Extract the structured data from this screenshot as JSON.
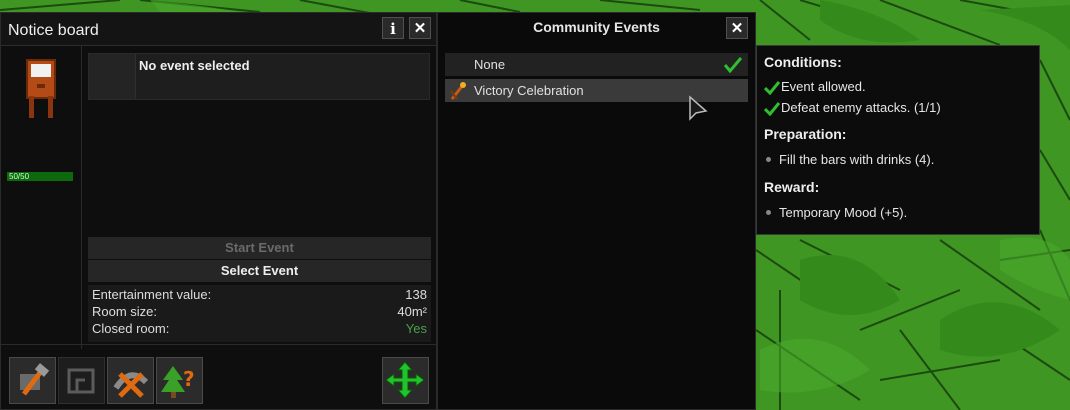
{
  "notice_board": {
    "title": "Notice board",
    "info_button": "i",
    "close_button": "✕",
    "health_text": "50/50",
    "selected_event": "No event selected",
    "start_event_label": "Start Event",
    "select_event_label": "Select Event",
    "stats": [
      {
        "label": "Entertainment value:",
        "value": "138"
      },
      {
        "label": "Room size:",
        "value": "40m²"
      },
      {
        "label": "Closed room:",
        "value": "Yes"
      }
    ],
    "toolbar": [
      "build-hammer-icon",
      "room-outline-icon",
      "demolish-icon",
      "tree-question-icon",
      "move-arrows-icon"
    ]
  },
  "community_events": {
    "title": "Community Events",
    "close_button": "✕",
    "items": [
      {
        "label": "None",
        "selected": true
      },
      {
        "label": "Victory Celebration",
        "selected": false
      }
    ]
  },
  "tooltip": {
    "conditions_header": "Conditions:",
    "conditions": [
      "Event allowed.",
      "Defeat enemy attacks. (1/1)"
    ],
    "preparation_header": "Preparation:",
    "preparation": [
      "Fill the bars with drinks (4)."
    ],
    "reward_header": "Reward:",
    "reward": [
      "Temporary Mood (+5)."
    ]
  },
  "colors": {
    "accent_green": "#2fbf2f",
    "disabled_text": "#6a6a6a",
    "yes_text": "#4aa04a"
  }
}
